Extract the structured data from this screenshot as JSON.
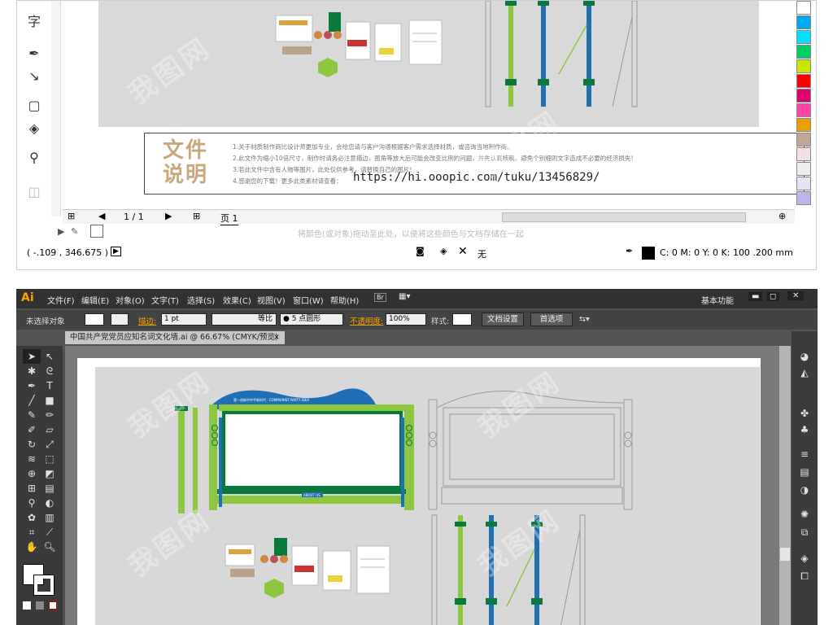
{
  "corel": {
    "tool_icons": [
      "text-tool-icon",
      "pen-tool-icon",
      "connector-tool-icon",
      "shape-tool-icon",
      "fill-tool-icon",
      "eyedropper-tool-icon",
      "transparency-tool-icon"
    ],
    "text_tool_glyph": "字",
    "info": {
      "title_line1": "文件",
      "title_line2": "说明",
      "lines": [
        "1.关于材质制作商比设计师更加专业，会给您请与客户沟通根据客户需求选择材质，或咨询当地制作商。",
        "2.此文件为缩小10倍尺寸，制作时请务必注意描边，图角等放大后可能会改变比例的问题，并先认真核稿，避免个别细则文字造成不必要的经济损失！",
        "3.若此文件中含有人物等图片，此处仅供参考，请替换自己的图片！",
        "4.感谢您的下载！更多此类素材请查看："
      ],
      "url": "https://hi.ooopic.com/tuku/13456829/"
    },
    "nav": {
      "page_count": "1 / 1",
      "page_tab": "页 1"
    },
    "hint": "将颜色(或对象)拖动至此处，以便将这些颜色与文档存储在一起",
    "status": {
      "coords": "( -.109 , 346.675 )",
      "fill_label": "无",
      "outline": "C: 0 M: 0 Y: 0 K: 100  .200 mm"
    },
    "palette": [
      "#ffffff",
      "#00aaee",
      "#00e0ff",
      "#00cc66",
      "#c8e600",
      "#ff0000",
      "#e0006e",
      "#ff44aa",
      "#e8a000",
      "#c0a898",
      "#f6e0e6",
      "#eeeeee",
      "#e8e0f4",
      "#c0b4e8",
      "#9a88e0",
      "#b4aaee"
    ]
  },
  "ai": {
    "app_logo": "Ai",
    "menu": [
      "文件(F)",
      "编辑(E)",
      "对象(O)",
      "文字(T)",
      "选择(S)",
      "效果(C)",
      "视图(V)",
      "窗口(W)",
      "帮助(H)"
    ],
    "workspace": "基本功能",
    "control": {
      "selection": "未选择对象",
      "stroke_label": "描边:",
      "stroke_value": "1 pt",
      "stroke_style": "等比",
      "brush": "● 5 点圆形",
      "opacity_label": "不透明度:",
      "opacity_value": "100%",
      "style_label": "样式:",
      "doc_setup": "文档设置",
      "prefs": "首选项"
    },
    "tab_title": "中国共产党党员应知名词文化墙.ai @ 66.67% (CMYK/预览)",
    "tab_close": "×",
    "panel_icons": [
      "color-panel-icon",
      "color-guide-icon",
      "brushes-icon",
      "symbols-icon",
      "stroke-icon",
      "gradient-icon",
      "transparency-icon",
      "appearance-icon",
      "graphic-styles-icon",
      "layers-icon",
      "artboards-icon"
    ],
    "tool_icons": [
      "selection-tool-icon",
      "direct-selection-tool-icon",
      "magic-wand-icon",
      "lasso-icon",
      "pen-tool-icon",
      "type-tool-icon",
      "line-tool-icon",
      "rectangle-tool-icon",
      "paintbrush-icon",
      "pencil-icon",
      "blob-brush-icon",
      "eraser-icon",
      "rotate-icon",
      "scale-icon",
      "warp-icon",
      "free-transform-icon",
      "shape-builder-icon",
      "perspective-icon",
      "mesh-icon",
      "gradient-tool-icon",
      "eyedropper-tool-icon",
      "blend-icon",
      "symbol-sprayer-icon",
      "graph-tool-icon",
      "artboard-tool-icon",
      "slice-icon",
      "hand-icon",
      "zoom-icon"
    ],
    "board_banner": "第一创新中中平新时代 · COMMUNIST PARTY IDEA",
    "board_caption": "ABOUT US",
    "colors": {
      "green": "#8dc63f",
      "blue": "#1f6fb7",
      "dark_green": "#0a7a3c",
      "gray_line": "#9a9a9a"
    }
  },
  "watermark": "我图网"
}
